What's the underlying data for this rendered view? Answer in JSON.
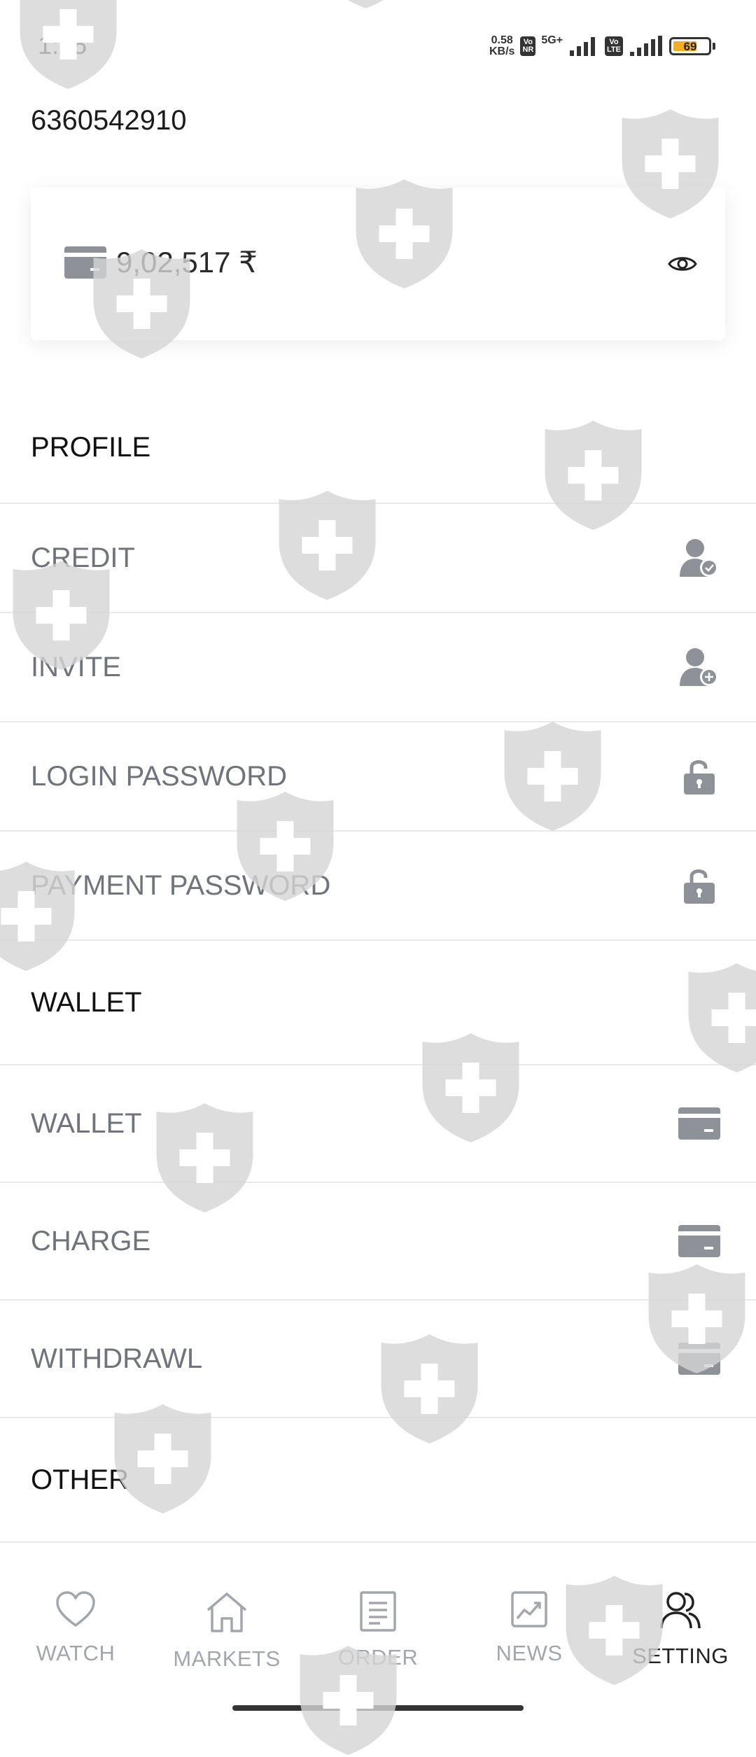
{
  "status_bar": {
    "time": "1:05",
    "net_speed_value": "0.58",
    "net_speed_unit": "KB/s",
    "chip1_top": "Vo",
    "chip1_bottom": "NR",
    "network": "5G+",
    "chip2_top": "Vo",
    "chip2_bottom": "LTE",
    "battery": "69",
    "battery_level": 0.69,
    "battery_color": "#f0b022"
  },
  "account": {
    "id": "6360542910"
  },
  "balance": {
    "amount": "9,02,517 ₹",
    "wallet_icon": "wallet-icon",
    "toggle_icon": "eye-icon"
  },
  "menu": {
    "profile_header": "PROFILE",
    "credit": "CREDIT",
    "invite": "INVITE",
    "login_password": "LOGIN PASSWORD",
    "payment_password": "PAYMENT PASSWORD",
    "wallet_header": "WALLET",
    "wallet": "WALLET",
    "charge": "CHARGE",
    "withdraw": "WITHDRAWL",
    "other_header": "OTHER"
  },
  "nav": {
    "watch": "WATCH",
    "markets": "MARKETS",
    "order": "ORDER",
    "news": "NEWS",
    "setting": "SETTING",
    "active": "SETTING"
  },
  "colors": {
    "icon_gray": "#8e9197",
    "text_muted": "#6f737b",
    "divider": "#e9e9e9",
    "watermark": "#d4d4d4"
  }
}
